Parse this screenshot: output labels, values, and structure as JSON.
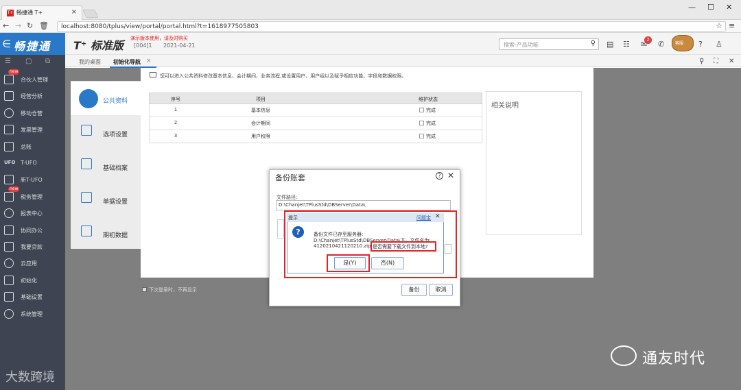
{
  "browser": {
    "tab_title": "畅捷通 T+",
    "favicon_text": "T+",
    "url": "localhost:8080/tplus/view/portal/portal.html?t=1618977505803"
  },
  "app": {
    "brand": "畅捷通",
    "edition": "T⁺ 标准版",
    "demo_note": "演示版本使用，请及时购买",
    "account_code": "[004]1",
    "account_date": "2021-04-21",
    "search_placeholder": "搜索-产品功能",
    "notification_count": "2",
    "mascot_label": "客服"
  },
  "sidebar": {
    "items": [
      {
        "label": "合伙人管理",
        "icon": "partner-icon",
        "badge": "new"
      },
      {
        "label": "经营分析",
        "icon": "analysis-icon"
      },
      {
        "label": "移动仓管",
        "icon": "mobile-warehouse-icon"
      },
      {
        "label": "发票管理",
        "icon": "invoice-icon"
      },
      {
        "label": "总账",
        "icon": "ledger-icon"
      },
      {
        "label": "T-UFO",
        "icon": "ufo-icon",
        "icon_text": "UFO"
      },
      {
        "label": "新T-UFO",
        "icon": "new-ufo-icon"
      },
      {
        "label": "税务管理",
        "icon": "tax-icon",
        "badge": "new"
      },
      {
        "label": "报表中心",
        "icon": "report-icon"
      },
      {
        "label": "协同办公",
        "icon": "collab-icon"
      },
      {
        "label": "我要贷款",
        "icon": "loan-icon"
      },
      {
        "label": "云应用",
        "icon": "cloud-icon"
      },
      {
        "label": "初始化",
        "icon": "init-icon"
      },
      {
        "label": "基础设置",
        "icon": "basic-settings-icon"
      },
      {
        "label": "系统管理",
        "icon": "system-icon"
      }
    ]
  },
  "portal_tabs": {
    "home": "我的桌面",
    "init_nav": "初始化导航"
  },
  "init": {
    "tip": "您可以进入公共资料修改基本信息、会计期间、业务流程,或设置用户、用户组以及赋予相应功能、字段和数据权限。",
    "steps": [
      {
        "label": "公共资料",
        "active": true
      },
      {
        "label": "选项设置"
      },
      {
        "label": "基础档案"
      },
      {
        "label": "单据设置"
      },
      {
        "label": "期初数据"
      }
    ],
    "table": {
      "headers": [
        "序号",
        "项目",
        "维护状态"
      ],
      "rows": [
        {
          "no": "1",
          "item": "基本信息",
          "status": "完成"
        },
        {
          "no": "2",
          "item": "会计期间",
          "status": "完成"
        },
        {
          "no": "3",
          "item": "用户权限",
          "status": "完成"
        }
      ]
    },
    "desc_title": "相关说明",
    "no_show_label": "下次登录时，不再显示"
  },
  "backup_dialog": {
    "title": "备份账套",
    "path_label": "文件路径:",
    "path_value": "D:\\Chanjet\\TPlusStd\\DBServer\\Data\\",
    "backup_button": "备份",
    "cancel_button": "取消"
  },
  "prompt": {
    "title": "提示",
    "help_link": "问题宝",
    "line1": "备份文件已存至服务器:",
    "line2": "D:\\Chanjet\\TPlusStd\\DBServer\\Data\\下，文件名为:",
    "line3": "41202104211202​10.zip,",
    "question": "是否需要下载文件到本地?",
    "yes_button": "是(Y)",
    "no_button": "否(N)"
  },
  "watermarks": {
    "left": "大数跨境",
    "right": "通友时代"
  }
}
